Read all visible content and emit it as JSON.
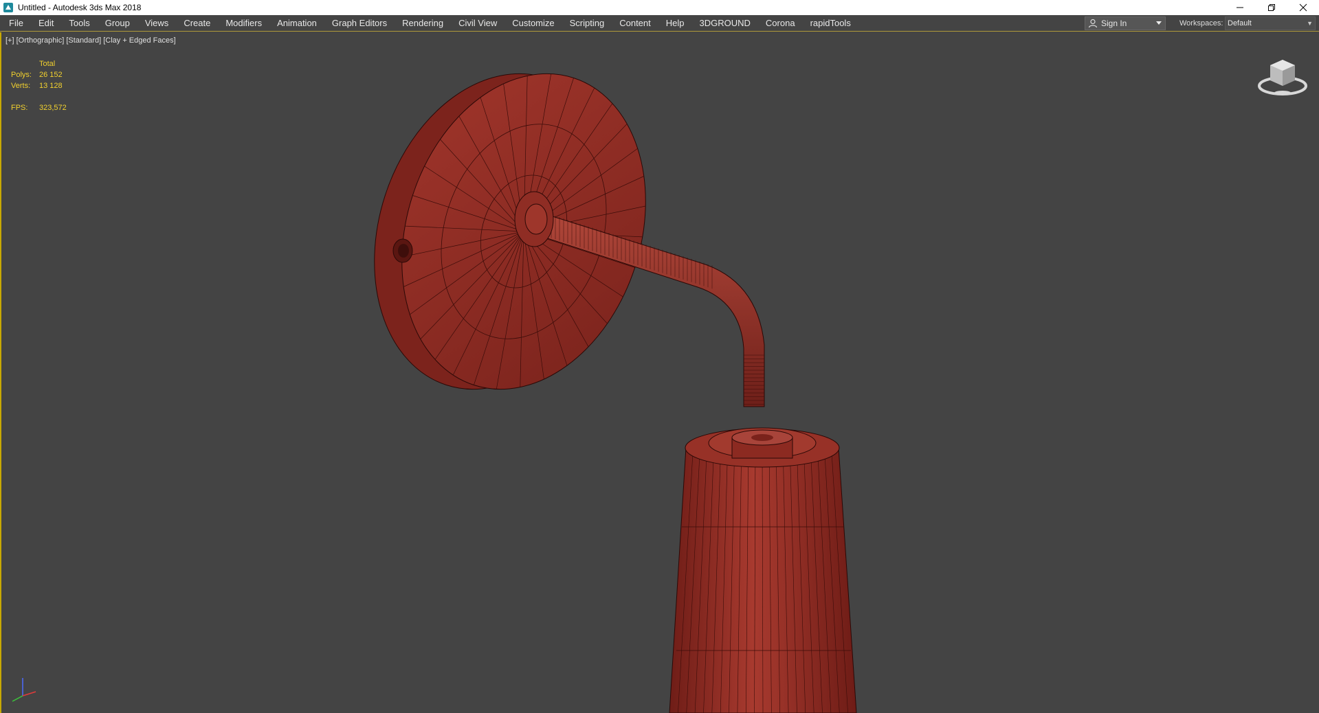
{
  "window": {
    "title": "Untitled - Autodesk 3ds Max 2018"
  },
  "menu": {
    "items": [
      "File",
      "Edit",
      "Tools",
      "Group",
      "Views",
      "Create",
      "Modifiers",
      "Animation",
      "Graph Editors",
      "Rendering",
      "Civil View",
      "Customize",
      "Scripting",
      "Content",
      "Help",
      "3DGROUND",
      "Corona",
      "rapidTools"
    ],
    "sign_in": "Sign In",
    "workspaces_label": "Workspaces:",
    "workspace_value": "Default"
  },
  "viewport": {
    "label_plus": "[+]",
    "label_view": "[Orthographic]",
    "label_shading": "[Standard]",
    "label_style": "[Clay + Edged Faces]",
    "background_color": "#444444",
    "model_color": "#8b2a22"
  },
  "stats": {
    "total_label": "Total",
    "polys_label": "Polys:",
    "polys_value": "26 152",
    "verts_label": "Verts:",
    "verts_value": "13 128",
    "fps_label": "FPS:",
    "fps_value": "323,572"
  },
  "icons": {
    "app": "3dsmax-app-icon",
    "minimize": "minimize-icon",
    "restore": "restore-icon",
    "close": "close-icon",
    "user": "user-icon",
    "viewcube": "viewcube-icon",
    "axis": "axis-tripod-icon"
  }
}
